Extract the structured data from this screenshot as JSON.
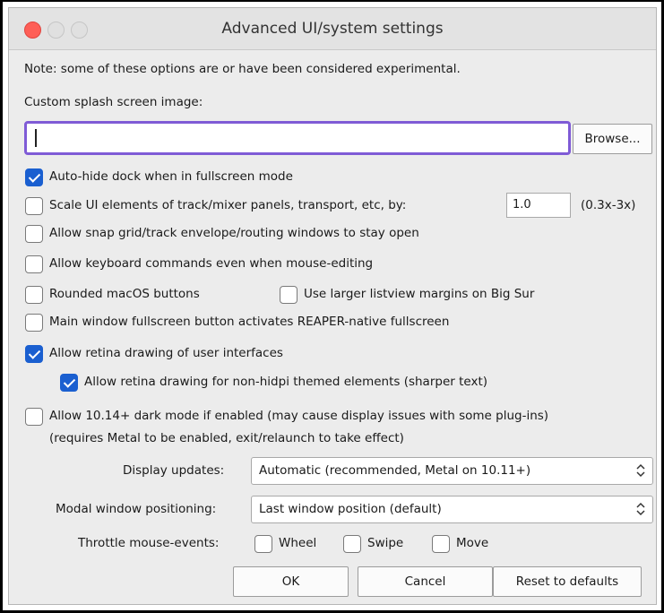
{
  "window": {
    "title": "Advanced UI/system settings"
  },
  "note": "Note: some of these options are or have been considered experimental.",
  "splash": {
    "label": "Custom splash screen image:",
    "value": "",
    "browse_label": "Browse..."
  },
  "options": {
    "autohide_dock": {
      "label": "Auto-hide dock when in fullscreen mode",
      "checked": true
    },
    "scale_ui": {
      "label": "Scale UI elements of track/mixer panels, transport, etc, by:",
      "checked": false,
      "value": "1.0",
      "range": "(0.3x-3x)"
    },
    "snap_grid": {
      "label": "Allow snap grid/track envelope/routing windows to stay open",
      "checked": false
    },
    "keyboard_commands": {
      "label": "Allow keyboard commands even when mouse-editing",
      "checked": false
    },
    "rounded_buttons": {
      "label": "Rounded macOS buttons",
      "checked": false
    },
    "larger_margins": {
      "label": "Use larger listview margins on Big Sur",
      "checked": false
    },
    "fullscreen_button": {
      "label": "Main window fullscreen button activates REAPER-native fullscreen",
      "checked": false
    },
    "retina_drawing": {
      "label": "Allow retina drawing of user interfaces",
      "checked": true
    },
    "retina_nonhidpi": {
      "label": "Allow retina drawing for non-hidpi themed elements (sharper text)",
      "checked": true
    },
    "dark_mode": {
      "label": "Allow 10.14+ dark mode if enabled (may cause display issues with some plug-ins)",
      "sublabel": "(requires Metal to be enabled, exit/relaunch to take effect)",
      "checked": false
    }
  },
  "display_updates": {
    "label": "Display updates:",
    "selected": "Automatic (recommended, Metal on 10.11+)"
  },
  "modal_positioning": {
    "label": "Modal window positioning:",
    "selected": "Last window position (default)"
  },
  "throttle": {
    "label": "Throttle mouse-events:",
    "wheel": {
      "label": "Wheel",
      "checked": false
    },
    "swipe": {
      "label": "Swipe",
      "checked": false
    },
    "move": {
      "label": "Move",
      "checked": false
    }
  },
  "buttons": {
    "ok": "OK",
    "cancel": "Cancel",
    "reset": "Reset to defaults"
  },
  "colors": {
    "accent": "#1a5fd0",
    "focus_ring": "#7f5bd6",
    "close": "#fe5f57"
  }
}
